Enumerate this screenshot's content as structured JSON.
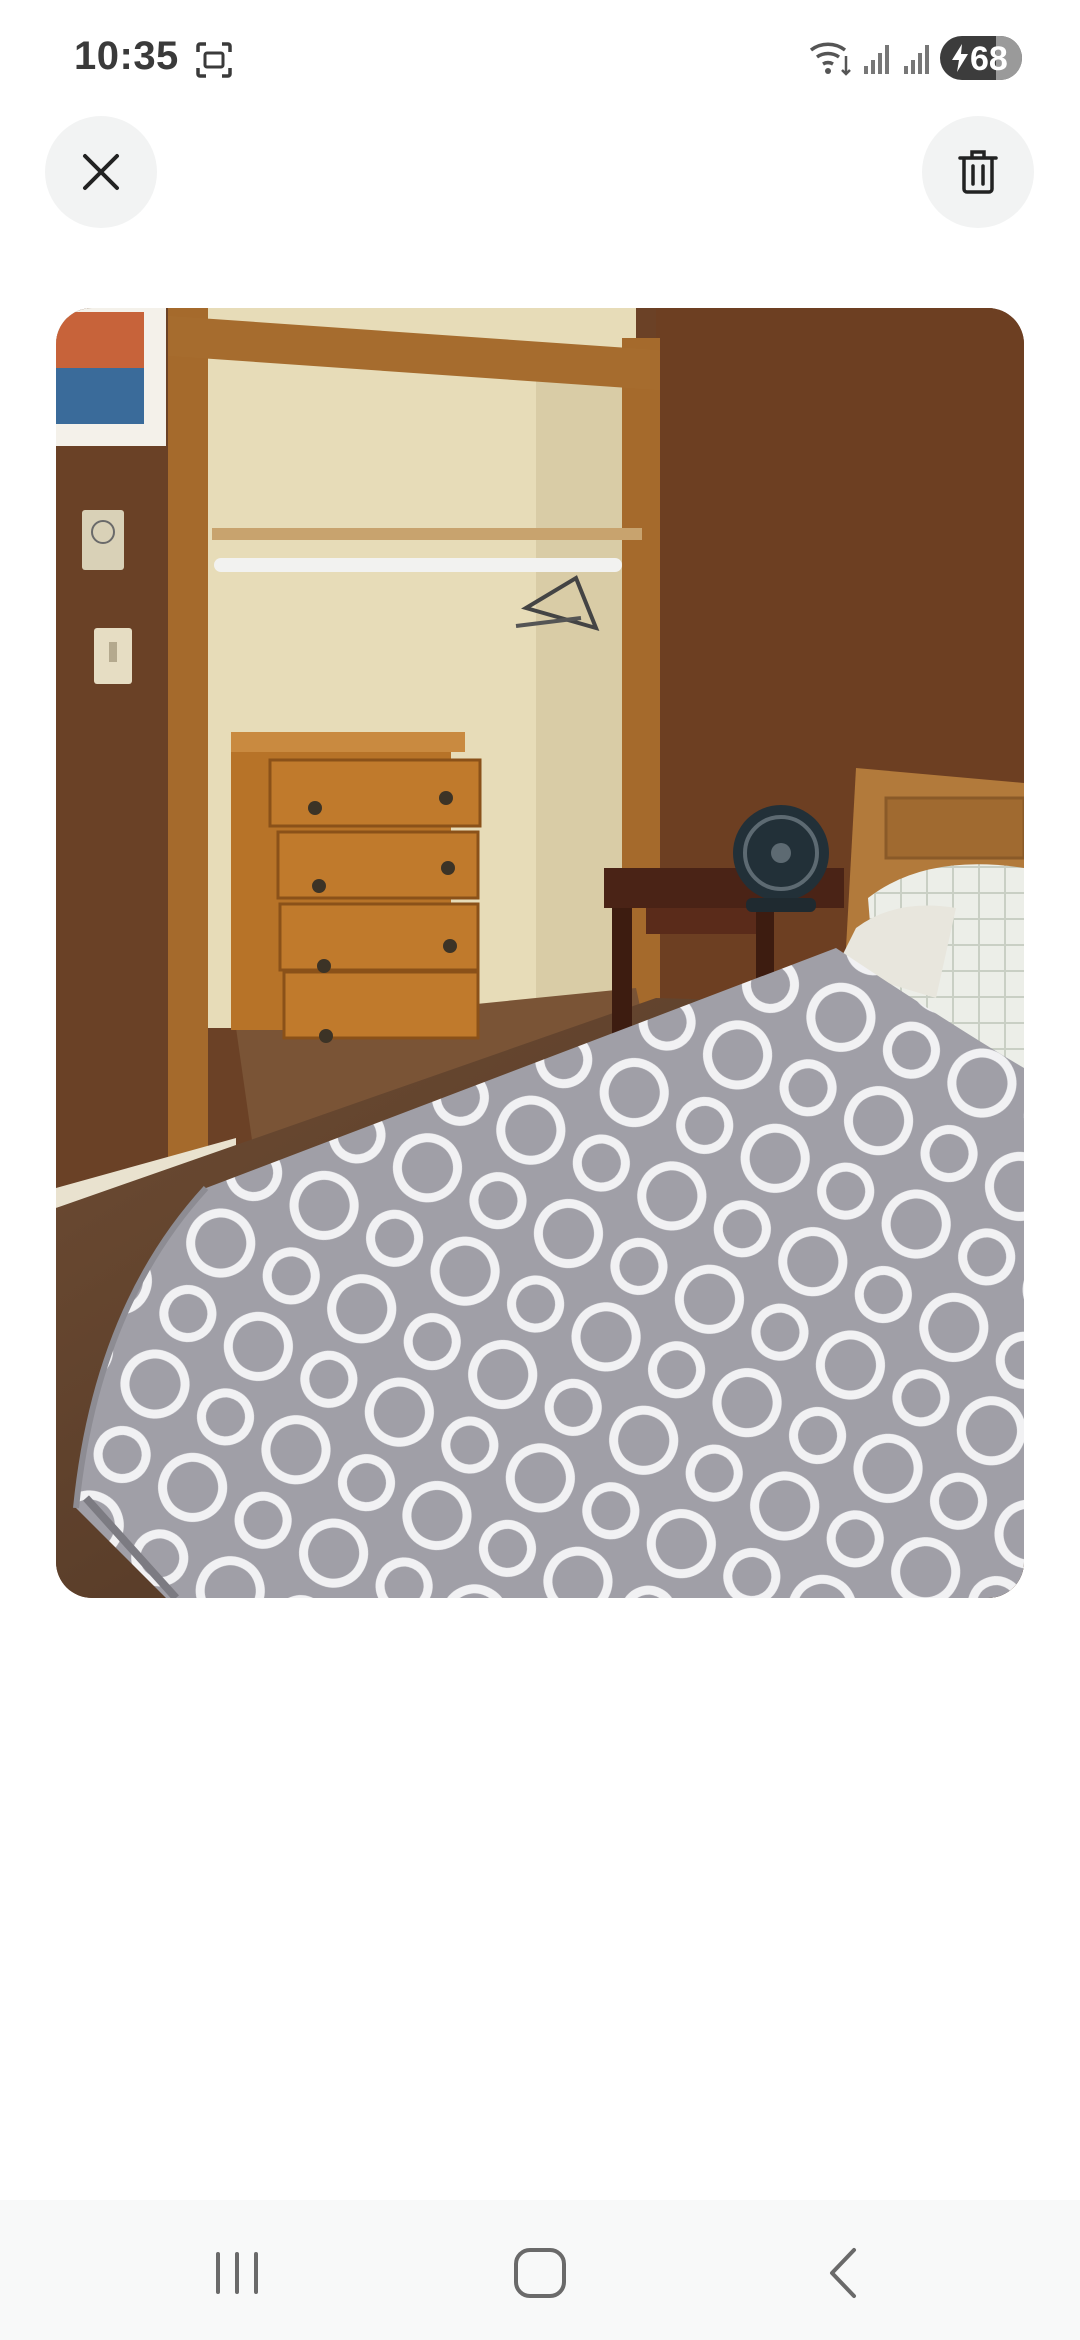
{
  "status_bar": {
    "time": "10:35",
    "battery_percent": "68",
    "battery_level": 0.68,
    "icons": [
      "screenshot-icon",
      "wifi-icon",
      "signal-icon",
      "signal-icon",
      "charging-bolt-icon"
    ]
  },
  "toolbar": {
    "close_icon": "close-icon",
    "delete_icon": "trash-icon"
  },
  "photo": {
    "subject": "bedroom-photo"
  },
  "nav_bar": {
    "icons": [
      "recents-icon",
      "home-icon",
      "back-icon"
    ]
  },
  "colors": {
    "background": "#ffffff",
    "button_bg": "#f2f3f3",
    "icon": "#222222",
    "nav_bg": "#f8f9f9",
    "nav_icon": "#6a6a6a"
  }
}
